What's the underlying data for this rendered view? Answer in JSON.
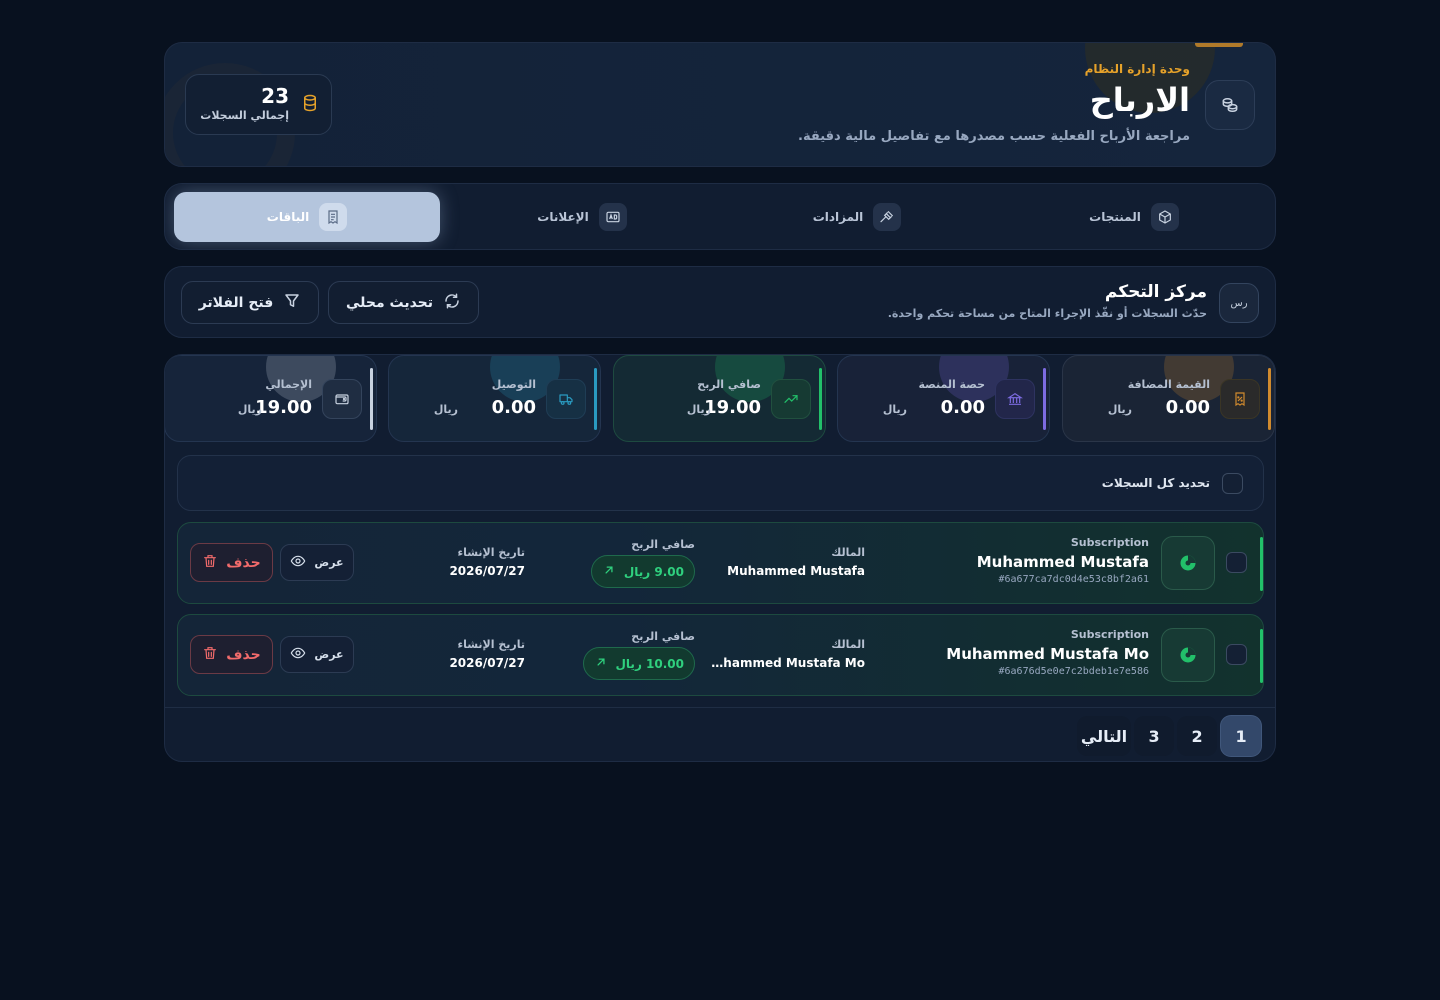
{
  "header": {
    "kicker": "وحدة إدارة النظام",
    "title": "الارباح",
    "subtitle": "مراجعة الأرباح الفعلية حسب مصدرها مع تفاصيل مالية دقيقة.",
    "total_count": "23",
    "total_label": "إجمالي السجلات"
  },
  "tabs": [
    {
      "label": "المنتجات",
      "icon": "box-icon"
    },
    {
      "label": "المزادات",
      "icon": "gavel-icon"
    },
    {
      "label": "الإعلانات",
      "icon": "ad-icon"
    },
    {
      "label": "الباقات",
      "icon": "receipt-icon",
      "active": true
    }
  ],
  "control": {
    "icon_text": "رس",
    "title": "مركز التحكم",
    "subtitle": "حدّث السجلات أو نفّذ الإجراء المتاح من مساحة تحكم واحدة.",
    "refresh_label": "تحديث محلي",
    "filters_label": "فتح الفلاتر"
  },
  "stats": [
    {
      "label": "القيمة المضافة",
      "value": "0.00",
      "currency": "ريال",
      "color": "#d08a2e",
      "icon": "receipt-percent-icon"
    },
    {
      "label": "حصة المنصة",
      "value": "0.00",
      "currency": "ريال",
      "color": "#7c6be0",
      "icon": "bank-icon"
    },
    {
      "label": "صافي الربح",
      "value": "19.00",
      "currency": "ريال",
      "color": "#22c06a",
      "icon": "trending-up-icon"
    },
    {
      "label": "التوصيل",
      "value": "0.00",
      "currency": "ريال",
      "color": "#2a9ac0",
      "icon": "truck-icon"
    },
    {
      "label": "الإجمالي",
      "value": "19.00",
      "currency": "ريال",
      "color": "#c8d2e0",
      "icon": "wallet-icon"
    }
  ],
  "select_all_label": "تحديد كل السجلات",
  "columns": {
    "owner": "المالك",
    "net_profit": "صافي الربح",
    "created": "تاريخ الإنشاء"
  },
  "rows": [
    {
      "type": "Subscription",
      "name": "Muhammed Mustafa",
      "id": "#6a677ca7dc0d4e53c8bf2a61",
      "owner": "Muhammed Mustafa",
      "profit": "9.00 ريال",
      "date": "2026/07/27"
    },
    {
      "type": "Subscription",
      "name": "Muhammed Mustafa Mo",
      "id": "#6a676d5e0e7c2bdeb1e7e586",
      "owner": "Muhammed Mustafa Mo",
      "profit": "10.00 ريال",
      "date": "2026/07/27"
    }
  ],
  "actions": {
    "view_label": "عرض",
    "delete_label": "حذف"
  },
  "pagination": {
    "pages": [
      "1",
      "2",
      "3"
    ],
    "current": "1",
    "next_label": "التالي"
  },
  "colors": {
    "background": "#08111f",
    "accent_gold": "#e6a22a",
    "success": "#22c06a",
    "danger": "#f26b6b"
  }
}
